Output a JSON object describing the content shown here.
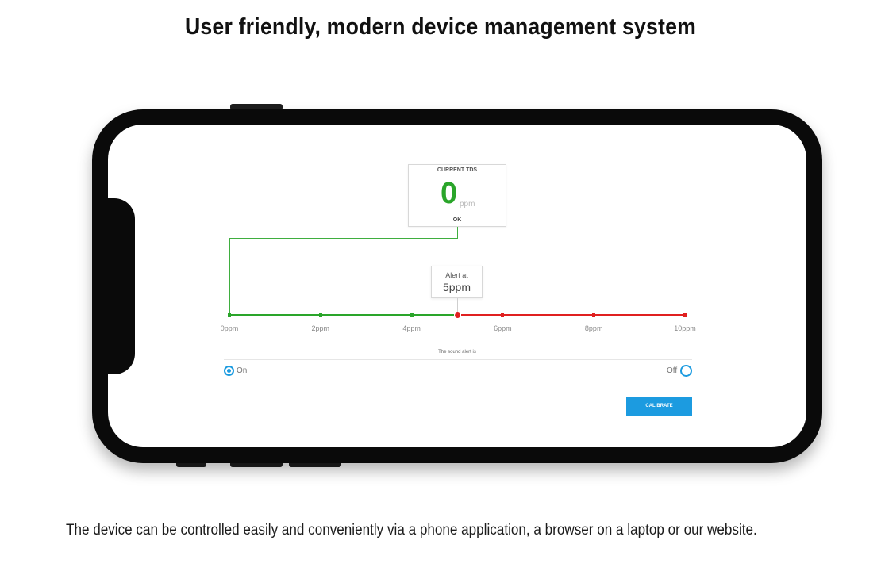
{
  "page": {
    "title": "User friendly, modern device management system",
    "description": "The device can be controlled easily and conveniently via a phone application, a browser on a laptop or our website."
  },
  "app": {
    "tds_card": {
      "label": "CURRENT TDS",
      "value": "0",
      "unit": "ppm",
      "status": "OK"
    },
    "alert": {
      "label": "Alert at",
      "value": "5ppm",
      "threshold_ppm": 5
    },
    "scale": {
      "ticks": [
        "0ppm",
        "2ppm",
        "4ppm",
        "6ppm",
        "8ppm",
        "10ppm"
      ],
      "current_ppm": 0,
      "max_ppm": 10
    },
    "sound_alert": {
      "title": "The sound alert is",
      "on_label": "On",
      "off_label": "Off",
      "selected": "On"
    },
    "calibrate_label": "CALIBRATE"
  },
  "colors": {
    "ok_green": "#2aa52a",
    "alert_red": "#e02020",
    "accent_blue": "#1c9be0"
  }
}
